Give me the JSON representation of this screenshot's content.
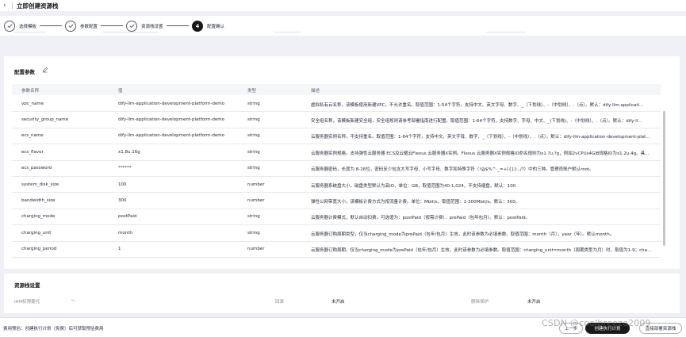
{
  "header": {
    "back_icon": "chevron-left-icon",
    "title": "立即创建资源栈"
  },
  "steps": [
    {
      "label": "选择模板",
      "state": "done",
      "icon": "check-icon"
    },
    {
      "label": "参数配置",
      "state": "done",
      "icon": "check-icon"
    },
    {
      "label": "资源栈设置",
      "state": "done",
      "icon": "check-icon"
    },
    {
      "number": "4",
      "label": "配置确认",
      "state": "active"
    }
  ],
  "config_params": {
    "title": "配置参数",
    "edit_icon": "pencil-icon",
    "columns": [
      "参数名称",
      "值",
      "类型",
      "描述"
    ],
    "rows": [
      {
        "name": "vpc_name",
        "value": "dify-llm-application-development-platform-demo",
        "type": "string",
        "desc": "虚拟私有云名称，该模板使用新建VPC，不允许重名。取值范围：1-54个字符，支持中文、英文字母、数字、_（下划线）、-（中划线）、.（点）。默认：dify-llm-applicati..."
      },
      {
        "name": "security_group_name",
        "value": "dify-llm-application-development-platform-demo",
        "type": "string",
        "desc": "安全组名称，该模板新建安全组，安全组规则请参考部署指南进行配置。取值范围：1-64个字符，支持数字、字母、中文、_(下划线)、-（中划线）、.（点）。默认：dify-ll..."
      },
      {
        "name": "ecs_name",
        "value": "dify-llm-application-development-platform-demo",
        "type": "string",
        "desc": "云服务器实例名称，不支持重名。取值范围：1-64个字符，支持中文、英文字母、数字、_（下划线）、-（中划线）、.（点）。默认：dify-llm-application-development-plat..."
      },
      {
        "name": "ecs_flavor",
        "value": "x1.8u.16g",
        "type": "string",
        "desc": "云服务器实例规格，支持弹性云服务器 ECS及云耀云Flexus 云服务器X实例。Flexus 云服务器X实例规格ID命名规则为x1.?u.?g，例如2vCPUs4GiB规格ID为x1.2u.4g。具..."
      },
      {
        "name": "ecs_password",
        "value": "******",
        "type": "string",
        "desc": "云服务器密码，长度为 8-26位，密码至少包含大写字母、小写字母、数字和特殊字符（!@$%^-_=+[{}]:,./?）中的三种。管理员账户默认root。"
      },
      {
        "name": "system_disk_size",
        "value": "100",
        "type": "number",
        "desc": "云服务器系统盘大小，磁盘类型默认为高IO，单位：GB，取值范围为40-1,024，不支持缩盘。默认：100"
      },
      {
        "name": "bandwidth_size",
        "value": "300",
        "type": "number",
        "desc": "弹性公网带宽大小，该模板计费方式为按流量计费。单位：Mbit/s，取值范围：1-300Mbit/s。默认：300。"
      },
      {
        "name": "charging_mode",
        "value": "postPaid",
        "type": "string",
        "desc": "云服务器计费模式，默认自动扣费，可选值为：postPaid（按需计费）、prePaid（包年包月）。默认：postPaid。"
      },
      {
        "name": "charging_unit",
        "value": "month",
        "type": "string",
        "desc": "云服务器订购周期类型，仅当charging_mode为prePaid（包年/包月）生效，此时该参数为必填参数。取值范围：month（月），year（年）。默认month。"
      },
      {
        "name": "charging_period",
        "value": "1",
        "type": "number",
        "desc": "云服务器订购周期，仅当charging_mode为prePaid（包年/包月）生效，此时该参数为必填参数。取值范围：charging_unit=month（周期类型为月）时，取值为1-9；chargi..."
      }
    ]
  },
  "stack_settings": {
    "title": "资源栈设置",
    "items": [
      {
        "label": "IAM权限委托",
        "value": "--"
      },
      {
        "label": "回滚",
        "value": "未开启"
      },
      {
        "label": "删除保护",
        "value": "未开启"
      }
    ]
  },
  "footer": {
    "note": "费用预估：创建执行计划（免费）后可获取预估费用",
    "buttons": [
      "上一步",
      "创建执行计划",
      "直接部署资源栈"
    ],
    "watermark": "CSDN @coolbreeze2009"
  },
  "colors": {
    "primary": "#191919",
    "text": "#252b3a",
    "muted": "#8a8e99",
    "page_bg": "#eef0f5"
  }
}
